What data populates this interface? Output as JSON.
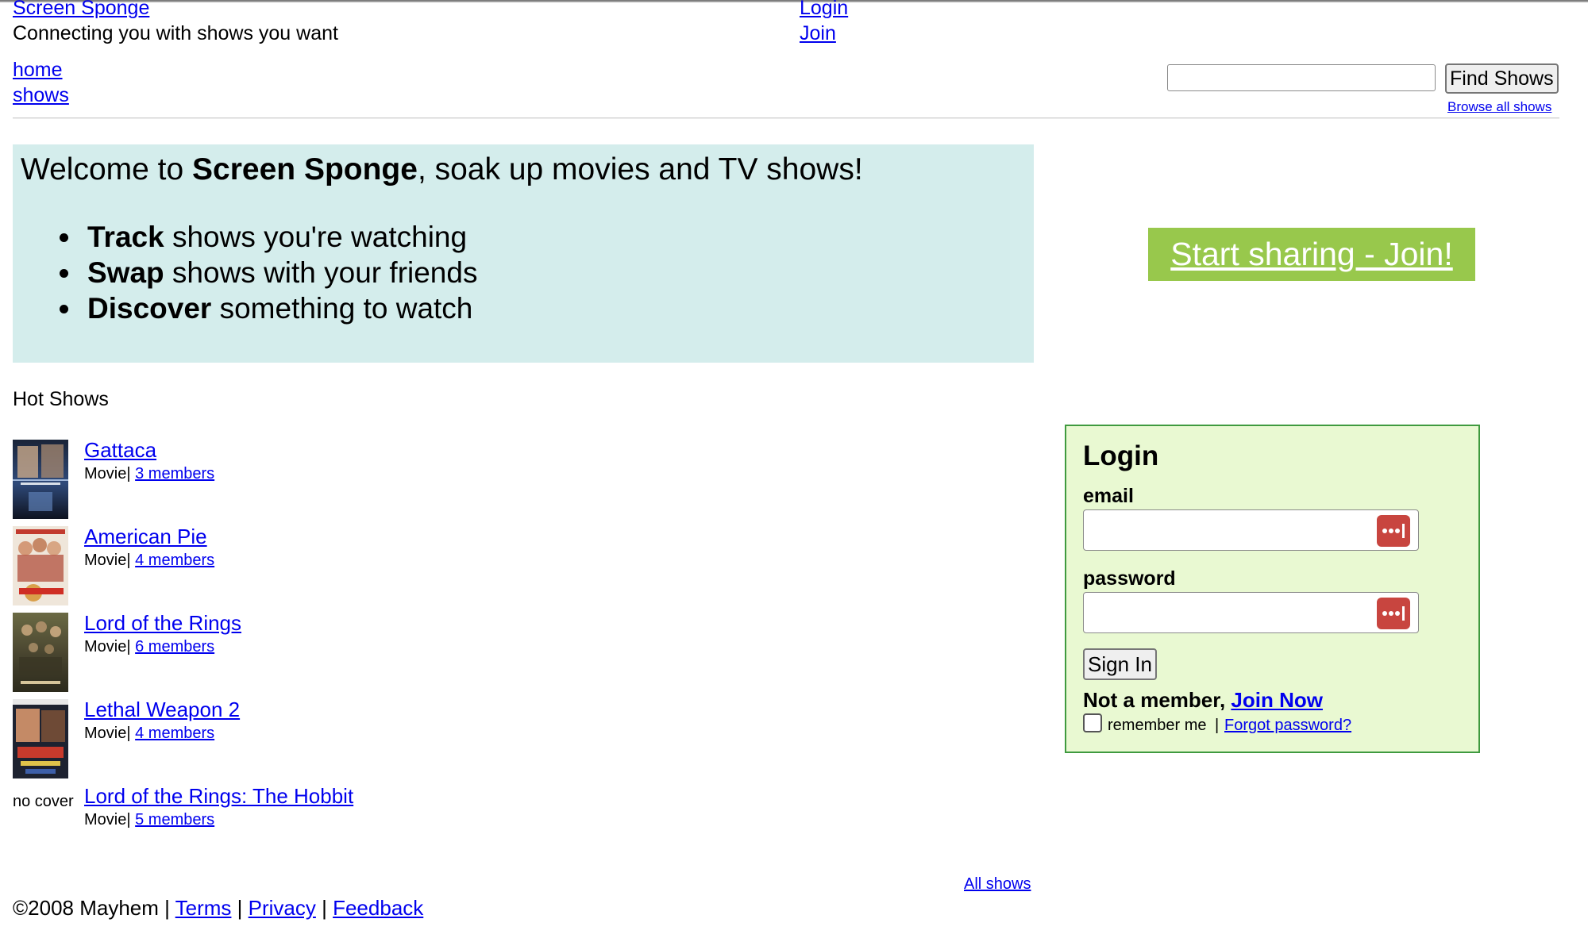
{
  "header": {
    "site_title": "Screen Sponge",
    "tagline": "Connecting you with shows you want",
    "login_link": "Login",
    "join_link": "Join"
  },
  "nav": {
    "home": "home",
    "shows": "shows"
  },
  "search": {
    "value": "",
    "button_label": "Find Shows",
    "browse_all": "Browse all shows"
  },
  "welcome": {
    "heading_prefix": "Welcome to ",
    "heading_brand": "Screen Sponge",
    "heading_suffix": ", soak up movies and TV shows!",
    "bullets": [
      {
        "bold": "Track",
        "rest": " shows you're watching"
      },
      {
        "bold": "Swap",
        "rest": " shows with your friends"
      },
      {
        "bold": "Discover",
        "rest": " something to watch"
      }
    ],
    "join_banner": "Start sharing - Join!"
  },
  "hot_shows": {
    "title": "Hot Shows",
    "items": [
      {
        "title": "Gattaca",
        "type": "Movie",
        "separator": "|",
        "members": "3 members",
        "cover": "gattaca-poster"
      },
      {
        "title": "American Pie",
        "type": "Movie",
        "separator": "|",
        "members": "4 members",
        "cover": "american-pie-poster"
      },
      {
        "title": "Lord of the Rings",
        "type": "Movie",
        "separator": "|",
        "members": "6 members",
        "cover": "lord-of-the-rings-poster"
      },
      {
        "title": "Lethal Weapon 2",
        "type": "Movie",
        "separator": "|",
        "members": "4 members",
        "cover": "lethal-weapon-2-poster"
      },
      {
        "title": "Lord of the Rings: The Hobbit",
        "type": "Movie",
        "separator": "|",
        "members": "5 members",
        "cover_text": "no cover"
      }
    ],
    "all_shows": "All shows"
  },
  "login": {
    "heading": "Login",
    "email_label": "email",
    "email_value": "",
    "password_label": "password",
    "password_value": "",
    "signin_button": "Sign In",
    "not_member_prefix": "Not a member, ",
    "join_now": "Join Now",
    "remember_label": "remember me",
    "remember_checked": false,
    "separator": "|",
    "forgot_password": "Forgot password?",
    "password_manager_icon": "password-manager-icon",
    "password_manager_color": "#c8453f"
  },
  "footer": {
    "copyright": "©2008 Mayhem",
    "sep": " | ",
    "terms": "Terms",
    "privacy": "Privacy",
    "feedback": "Feedback"
  },
  "colors": {
    "welcome_bg": "#d4edec",
    "join_banner_bg": "#98c84c",
    "login_bg": "#e9f9d2",
    "login_border": "#3f9a3f",
    "link": "#0000ee"
  }
}
